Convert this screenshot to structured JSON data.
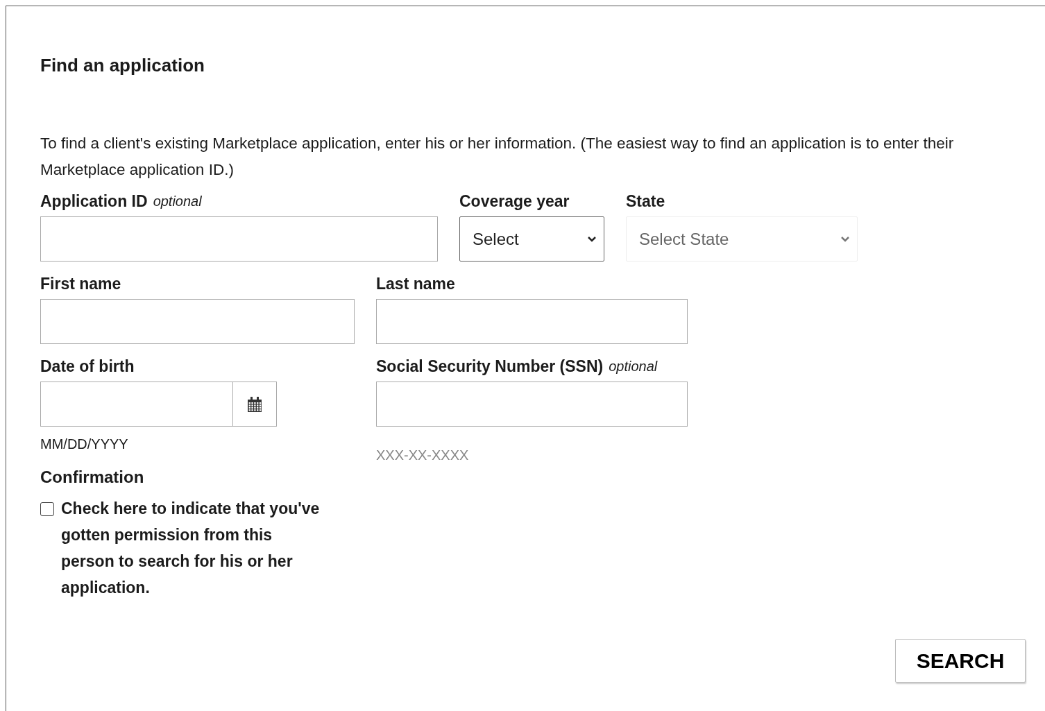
{
  "title": "Find an application",
  "intro": "To find a client's existing Marketplace application, enter his or her information. (The easiest way to find an application is to enter their Marketplace application ID.)",
  "fields": [
    {
      "kind": "text",
      "label": "Application ID",
      "note": "optional"
    },
    {
      "kind": "select",
      "label": "Coverage year",
      "value": "Select",
      "disabled": false
    },
    {
      "kind": "select",
      "label": "State",
      "value": "Select State",
      "disabled": true
    },
    {
      "kind": "text",
      "label": "First name"
    },
    {
      "kind": "text",
      "label": "Last name"
    },
    {
      "kind": "date",
      "label": "Date of birth",
      "hint": "MM/DD/YYYY"
    },
    {
      "kind": "text",
      "label": "Social Security Number (SSN)",
      "note": "optional",
      "hint": "XXX-XX-XXXX"
    }
  ],
  "confirmation": {
    "heading": "Confirmation",
    "label": "Check here to indicate that you've gotten permission from this person to search for his or her application.",
    "checked": false
  },
  "button": "SEARCH"
}
